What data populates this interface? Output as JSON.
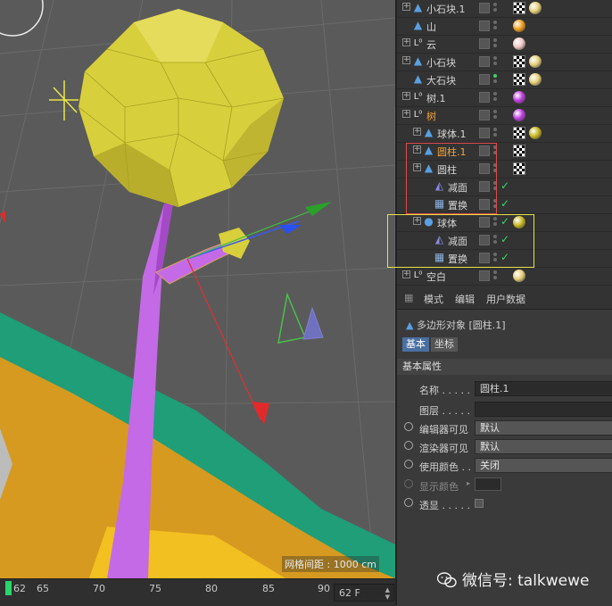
{
  "viewport": {
    "grid_spacing_label": "网格间距 : 1000 cm"
  },
  "timeline": {
    "ticks": [
      "62",
      "65",
      "70",
      "75",
      "80",
      "85",
      "90"
    ],
    "current_frame": "62 F"
  },
  "object_manager": {
    "rows": [
      {
        "name": "小石块.1",
        "icon": "polygon-icon",
        "tag": "checker",
        "ball": "#e6d07a"
      },
      {
        "name": "山",
        "icon": "polygon-icon",
        "tag": "ball",
        "ball": "#f0a020"
      },
      {
        "name": "云",
        "icon": "null-icon",
        "tag": "ball",
        "ball": "#f0c8c8"
      },
      {
        "name": "小石块",
        "icon": "polygon-icon",
        "tag": "checker",
        "ball": "#e6d07a"
      },
      {
        "name": "大石块",
        "icon": "polygon-icon",
        "tag": "checker",
        "ball": "#e6d07a"
      },
      {
        "name": "树.1",
        "icon": "null-icon",
        "tag": "ball",
        "ball": "#c040e0"
      },
      {
        "name": "树",
        "icon": "null-icon",
        "tag": "ball",
        "ball": "#c040e0"
      },
      {
        "name": "球体.1",
        "icon": "polygon-icon",
        "tag": "checker",
        "ball": "#c8b820"
      },
      {
        "name": "圆柱.1",
        "icon": "polygon-icon",
        "tag": "checker",
        "ball": ""
      },
      {
        "name": "圆柱",
        "icon": "polygon-icon",
        "tag": "checker",
        "ball": ""
      },
      {
        "name": "减面",
        "icon": "reduce-icon",
        "tag": "",
        "ball": ""
      },
      {
        "name": "置换",
        "icon": "displace-icon",
        "tag": "",
        "ball": ""
      },
      {
        "name": "球体",
        "icon": "sphere-icon",
        "tag": "ball",
        "ball": "#c8b820"
      },
      {
        "name": "减面",
        "icon": "reduce-icon",
        "tag": "",
        "ball": ""
      },
      {
        "name": "置换",
        "icon": "displace-icon",
        "tag": "",
        "ball": ""
      },
      {
        "name": "空白",
        "icon": "null-icon",
        "tag": "ball",
        "ball": "#e6d07a"
      }
    ]
  },
  "attributes": {
    "menu": [
      "模式",
      "编辑",
      "用户数据"
    ],
    "object_title": "多边形对象 [圆柱.1]",
    "tabs": [
      "基本",
      "坐标"
    ],
    "section": "基本属性",
    "name_label": "名称 . . . . .",
    "name_value": "圆柱.1",
    "layer_label": "图层 . . . . .",
    "editor_visible_label": "编辑器可见",
    "editor_visible_value": "默认",
    "render_visible_label": "渲染器可见",
    "render_visible_value": "默认",
    "use_color_label": "使用颜色 . .",
    "use_color_value": "关闭",
    "display_color_label": "显示颜色",
    "xray_label": "透显 . . . . ."
  },
  "watermark": {
    "text": "微信号: talkwewe"
  },
  "colors": {
    "tree_crown": "#d8cf3c",
    "tree_trunk": "#c46ae6",
    "ground_orange": "#d69a20",
    "ground_green": "#1f9e78",
    "highlight_red": "#e04a4a",
    "highlight_yellow": "#e6e24a",
    "active_tab": "#4a6fa0",
    "frame_cursor": "#29d46a"
  }
}
